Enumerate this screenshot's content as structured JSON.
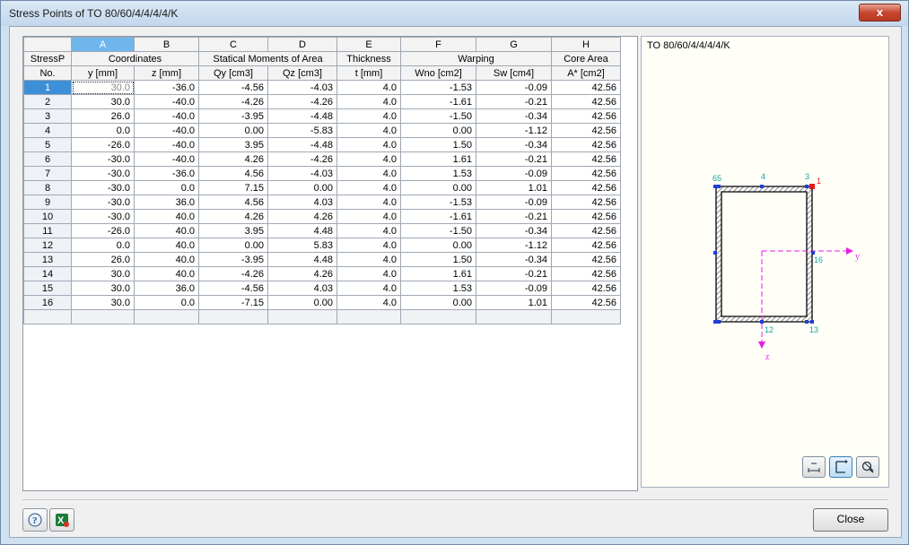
{
  "window": {
    "title": "Stress Points of TO 80/60/4/4/4/4/K",
    "close_glyph": "x"
  },
  "grid": {
    "col_letters": [
      "A",
      "B",
      "C",
      "D",
      "E",
      "F",
      "G",
      "H"
    ],
    "stressp_label": "StressP",
    "no_label": "No.",
    "groups": [
      "Coordinates",
      "Statical Moments of Area",
      "Thickness",
      "Warping",
      "Core Area"
    ],
    "units": [
      "y [mm]",
      "z [mm]",
      "Qy [cm3]",
      "Qz [cm3]",
      "t [mm]",
      "Wno [cm2]",
      "Sw [cm4]",
      "A* [cm2]"
    ],
    "rows": [
      [
        "1",
        "30.0",
        "-36.0",
        "-4.56",
        "-4.03",
        "4.0",
        "-1.53",
        "-0.09",
        "42.56"
      ],
      [
        "2",
        "30.0",
        "-40.0",
        "-4.26",
        "-4.26",
        "4.0",
        "-1.61",
        "-0.21",
        "42.56"
      ],
      [
        "3",
        "26.0",
        "-40.0",
        "-3.95",
        "-4.48",
        "4.0",
        "-1.50",
        "-0.34",
        "42.56"
      ],
      [
        "4",
        "0.0",
        "-40.0",
        "0.00",
        "-5.83",
        "4.0",
        "0.00",
        "-1.12",
        "42.56"
      ],
      [
        "5",
        "-26.0",
        "-40.0",
        "3.95",
        "-4.48",
        "4.0",
        "1.50",
        "-0.34",
        "42.56"
      ],
      [
        "6",
        "-30.0",
        "-40.0",
        "4.26",
        "-4.26",
        "4.0",
        "1.61",
        "-0.21",
        "42.56"
      ],
      [
        "7",
        "-30.0",
        "-36.0",
        "4.56",
        "-4.03",
        "4.0",
        "1.53",
        "-0.09",
        "42.56"
      ],
      [
        "8",
        "-30.0",
        "0.0",
        "7.15",
        "0.00",
        "4.0",
        "0.00",
        "1.01",
        "42.56"
      ],
      [
        "9",
        "-30.0",
        "36.0",
        "4.56",
        "4.03",
        "4.0",
        "-1.53",
        "-0.09",
        "42.56"
      ],
      [
        "10",
        "-30.0",
        "40.0",
        "4.26",
        "4.26",
        "4.0",
        "-1.61",
        "-0.21",
        "42.56"
      ],
      [
        "11",
        "-26.0",
        "40.0",
        "3.95",
        "4.48",
        "4.0",
        "-1.50",
        "-0.34",
        "42.56"
      ],
      [
        "12",
        "0.0",
        "40.0",
        "0.00",
        "5.83",
        "4.0",
        "0.00",
        "-1.12",
        "42.56"
      ],
      [
        "13",
        "26.0",
        "40.0",
        "-3.95",
        "4.48",
        "4.0",
        "1.50",
        "-0.34",
        "42.56"
      ],
      [
        "14",
        "30.0",
        "40.0",
        "-4.26",
        "4.26",
        "4.0",
        "1.61",
        "-0.21",
        "42.56"
      ],
      [
        "15",
        "30.0",
        "36.0",
        "-4.56",
        "4.03",
        "4.0",
        "1.53",
        "-0.09",
        "42.56"
      ],
      [
        "16",
        "30.0",
        "0.0",
        "-7.15",
        "0.00",
        "4.0",
        "0.00",
        "1.01",
        "42.56"
      ]
    ]
  },
  "preview": {
    "title": "TO 80/60/4/4/4/4/K",
    "labels": {
      "p65": "65",
      "p4": "4",
      "p3": "3",
      "p1": "1",
      "p16": "16",
      "p12": "12",
      "p13": "13",
      "axis_y": "y",
      "axis_z": "z"
    },
    "colors": {
      "section_outline": "#000000",
      "points": "#1f3fd6",
      "point_labels": "#1aa39a",
      "axes": "#e61ee6",
      "selected_point": "#e31b1b"
    },
    "buttons": [
      "ruler-icon",
      "axes-icon",
      "zoom-reset-icon"
    ]
  },
  "footer": {
    "close_label": "Close"
  }
}
